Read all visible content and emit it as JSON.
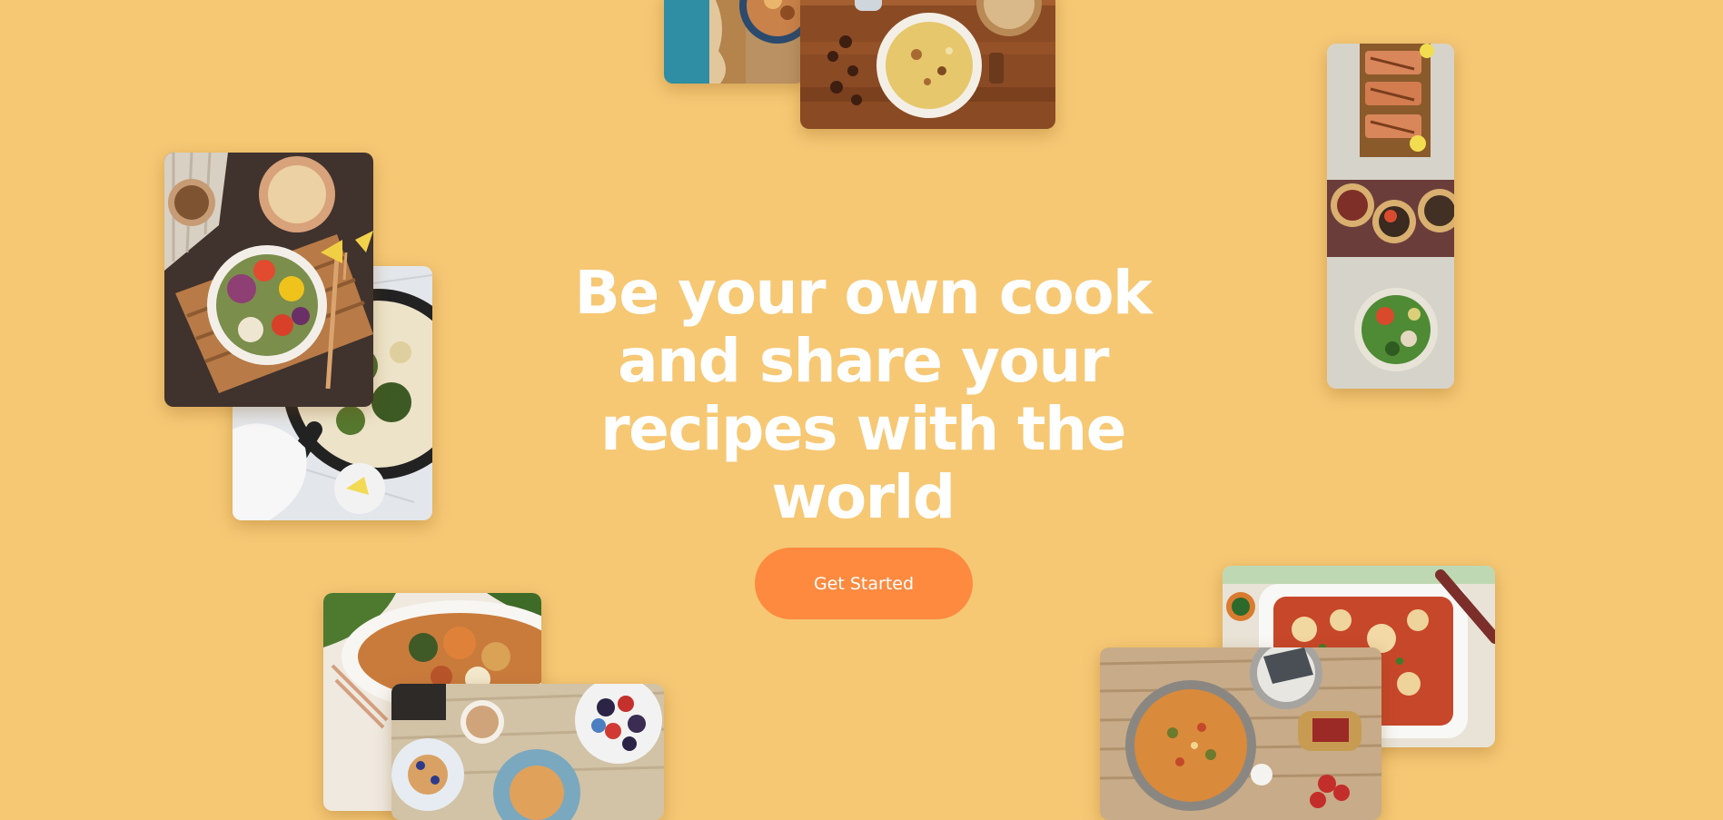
{
  "hero": {
    "headline": "Be your own cook and share your recipes with the world",
    "cta_label": "Get Started"
  },
  "colors": {
    "background": "#f6c874",
    "headline": "#ffffff",
    "cta_background": "#fd8a3f",
    "cta_text": "#ffffff"
  },
  "food_images": [
    {
      "name": "teal-cloth-dish-photo"
    },
    {
      "name": "quiche-on-wooden-board-photo"
    },
    {
      "name": "hummus-salad-bowl-photo"
    },
    {
      "name": "spinach-skillet-photo"
    },
    {
      "name": "grilled-salmon-tostadas-photo"
    },
    {
      "name": "rice-stew-plate-photo"
    },
    {
      "name": "pancake-berries-breakfast-photo"
    },
    {
      "name": "lasagna-casserole-dish-photo"
    },
    {
      "name": "frittata-pan-photo"
    }
  ]
}
